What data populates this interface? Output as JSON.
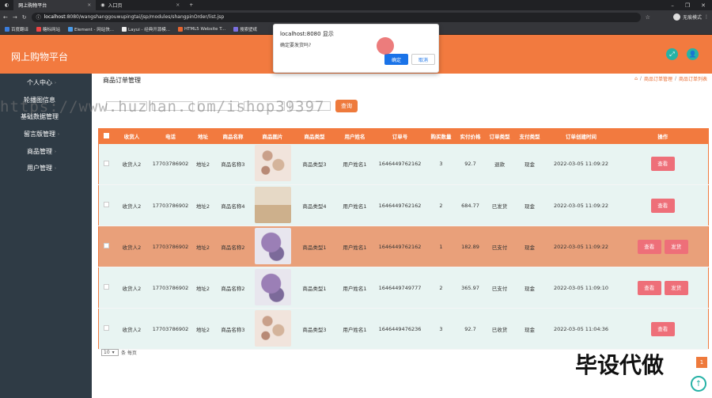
{
  "browser": {
    "tabs": [
      {
        "label": "网上购物平台",
        "close": "×"
      },
      {
        "label": "入口页",
        "close": "×"
      }
    ],
    "new_tab": "+",
    "url_host": "localhost",
    "url_rest": ":8080/wangshanggouwupingtai/jsp/modules/shangpinOrder/list.jsp",
    "profile_label": "无痕模式",
    "bookmarks": [
      "百度翻译",
      "糖标网站",
      "Element - 网站快...",
      "Layui - 经典开源模...",
      "HTML5 Website T...",
      "搜索壁纸"
    ]
  },
  "header": {
    "brand": "网上购物平台",
    "btn1_icon": "⤢",
    "btn2_icon": "👤"
  },
  "sidebar": {
    "items": [
      {
        "label": "个人中心",
        "chev": "›"
      },
      {
        "label": "轮播图信息",
        "chev": ""
      },
      {
        "label": "基础数据管理",
        "chev": ""
      },
      {
        "label": "留言版管理",
        "chev": "›"
      },
      {
        "label": "商品管理",
        "chev": "›"
      },
      {
        "label": "用户管理",
        "chev": "›"
      }
    ]
  },
  "main": {
    "title": "商品订单管理",
    "breadcrumb": [
      "商品订单管理",
      "商品订单列表"
    ],
    "search_btn": "查询"
  },
  "watermark": "https://www.huzhan.com/ishop39397",
  "table": {
    "headers": [
      "收货人",
      "电话",
      "地址",
      "商品名称",
      "商品图片",
      "商品类型",
      "用户姓名",
      "订单号",
      "购买数量",
      "实付价格",
      "订单类型",
      "支付类型",
      "订单创建时间",
      "操作"
    ],
    "rows": [
      {
        "name": "收货人2",
        "phone": "17703786902",
        "addr": "地址2",
        "product": "商品名称3",
        "img": "cos",
        "type": "商品类型3",
        "user": "用户姓名1",
        "order": "1646449762162",
        "qty": "3",
        "price": "92.7",
        "status": "退款",
        "pay": "现金",
        "time": "2022-03-05 11:09:22",
        "view": "查看",
        "ship": ""
      },
      {
        "name": "收货人2",
        "phone": "17703786902",
        "addr": "地址2",
        "product": "商品名称4",
        "img": "box",
        "type": "商品类型4",
        "user": "用户姓名1",
        "order": "1646449762162",
        "qty": "2",
        "price": "684.77",
        "status": "已发货",
        "pay": "现金",
        "time": "2022-03-05 11:09:22",
        "view": "查看",
        "ship": ""
      },
      {
        "name": "收货人2",
        "phone": "17703786902",
        "addr": "地址2",
        "product": "商品名称2",
        "img": "flow",
        "type": "商品类型1",
        "user": "用户姓名1",
        "order": "1646449762162",
        "qty": "1",
        "price": "182.89",
        "status": "已支付",
        "pay": "现金",
        "time": "2022-03-05 11:09:22",
        "view": "查看",
        "ship": "发货"
      },
      {
        "name": "收货人2",
        "phone": "17703786902",
        "addr": "地址2",
        "product": "商品名称2",
        "img": "flow",
        "type": "商品类型1",
        "user": "用户姓名1",
        "order": "1646449749777",
        "qty": "2",
        "price": "365.97",
        "status": "已支付",
        "pay": "现金",
        "time": "2022-03-05 11:09:10",
        "view": "查看",
        "ship": "发货"
      },
      {
        "name": "收货人2",
        "phone": "17703786902",
        "addr": "地址2",
        "product": "商品名称3",
        "img": "cos",
        "type": "商品类型3",
        "user": "用户姓名1",
        "order": "1646449476236",
        "qty": "3",
        "price": "92.7",
        "status": "已收货",
        "pay": "现金",
        "time": "2022-03-05 11:04:36",
        "view": "查看",
        "ship": ""
      }
    ]
  },
  "pager": {
    "per_page": "10",
    "suffix": "条 每页",
    "page": "1"
  },
  "overlay_text": "毕设代做",
  "dialog": {
    "title": "localhost:8080 显示",
    "message": "确定要发货吗?",
    "ok": "确定",
    "cancel": "取消"
  }
}
